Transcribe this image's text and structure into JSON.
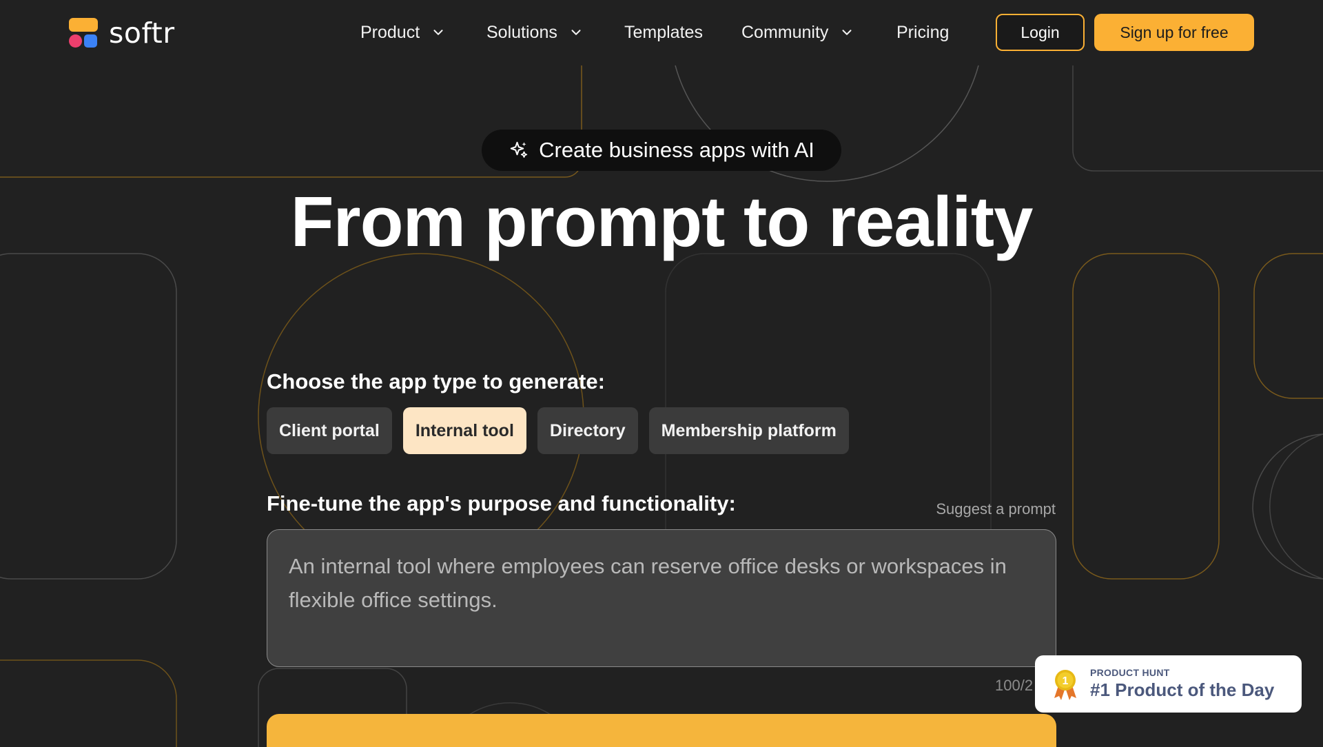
{
  "nav": {
    "logo_text": "softr",
    "links": [
      {
        "label": "Product",
        "has_dropdown": true
      },
      {
        "label": "Solutions",
        "has_dropdown": true
      },
      {
        "label": "Templates",
        "has_dropdown": false
      },
      {
        "label": "Community",
        "has_dropdown": true
      },
      {
        "label": "Pricing",
        "has_dropdown": false
      }
    ],
    "login_label": "Login",
    "signup_label": "Sign up for free"
  },
  "hero": {
    "pill_text": "Create business apps with AI",
    "headline": "From prompt to reality"
  },
  "generator": {
    "app_type_label": "Choose the app type to generate:",
    "app_types": [
      "Client portal",
      "Internal tool",
      "Directory",
      "Membership platform"
    ],
    "selected_app_type": "Internal tool",
    "finetune_label": "Fine-tune the app's purpose and functionality:",
    "suggest_label": "Suggest a prompt",
    "prompt_text": "An internal tool where employees can reserve office desks or workspaces in flexible office settings.",
    "char_counter": "100/2"
  },
  "badge": {
    "small_text": "PRODUCT HUNT",
    "main_text": "#1 Product of the Day",
    "medal_number": "1"
  },
  "colors": {
    "background": "#212121",
    "accent": "#fbb034",
    "chip": "#3b3b3b",
    "chip_selected": "#fde5c4"
  }
}
